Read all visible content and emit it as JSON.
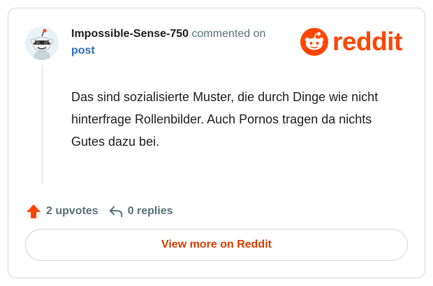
{
  "comment": {
    "username": "Impossible-Sense-750",
    "action": " commented on",
    "post_link": "post",
    "text": "Das sind sozialisierte Muster, die durch Dinge wie nicht hinterfrage Rollenbilder. Auch Pornos tragen da nichts Gutes dazu bei."
  },
  "brand": {
    "name": "reddit",
    "icon": "reddit-snoo-icon",
    "color": "#ff4500"
  },
  "stats": {
    "upvotes_label": "2 upvotes",
    "upvote_icon": "upvote-arrow-icon",
    "replies_label": "0 replies",
    "reply_icon": "reply-arrow-icon"
  },
  "cta": {
    "label": "View more on Reddit"
  },
  "colors": {
    "accent": "#ff4500",
    "link": "#2a6cbb",
    "muted": "#576f76",
    "cta_text": "#d93a00"
  }
}
